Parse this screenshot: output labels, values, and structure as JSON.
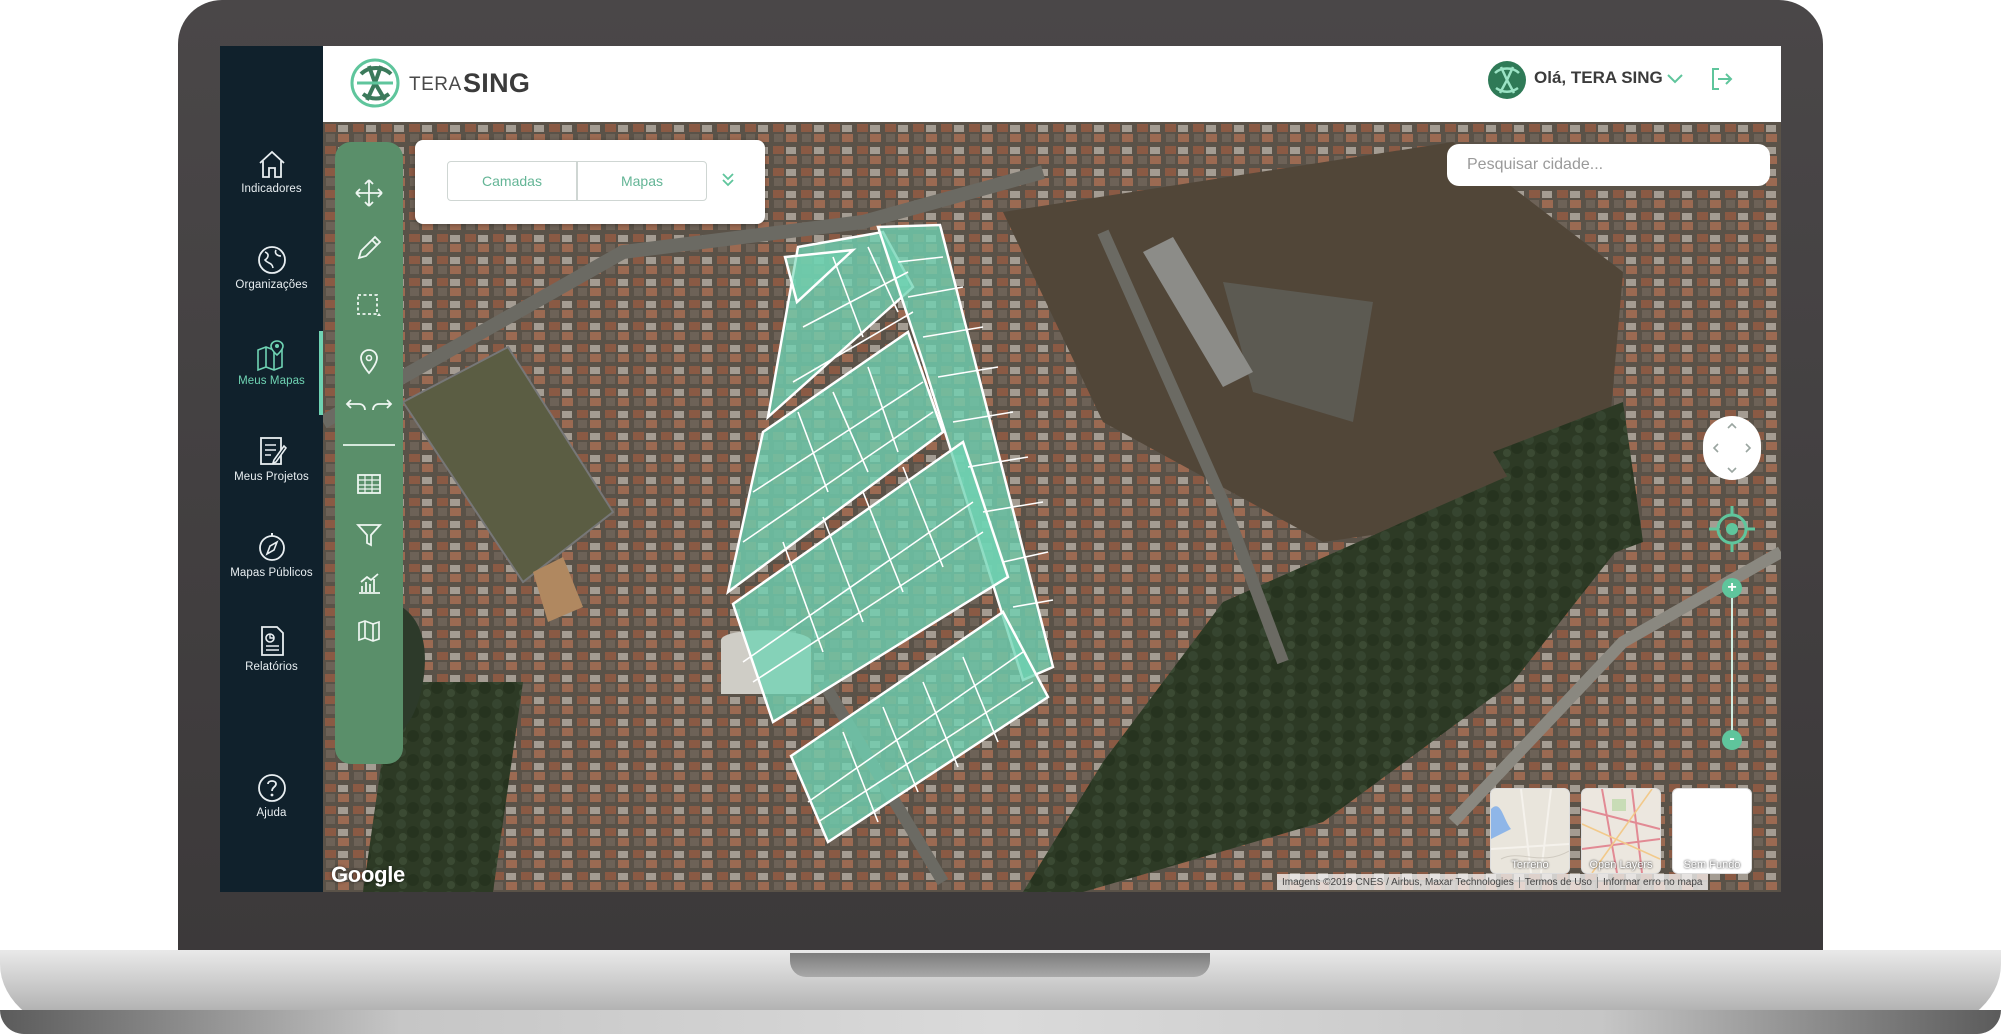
{
  "brand": {
    "prefix": "TERA",
    "name": "SING"
  },
  "header": {
    "greeting": "Olá, TERA SING"
  },
  "sidebar": {
    "items": [
      {
        "label": "Indicadores",
        "icon": "home-icon"
      },
      {
        "label": "Organizações",
        "icon": "globe-icon"
      },
      {
        "label": "Meus Mapas",
        "icon": "map-pin-icon",
        "active": true
      },
      {
        "label": "Meus Projetos",
        "icon": "document-pen-icon"
      },
      {
        "label": "Mapas Públicos",
        "icon": "compass-icon"
      },
      {
        "label": "Relatórios",
        "icon": "report-icon"
      },
      {
        "label": "Ajuda",
        "icon": "help-icon"
      }
    ]
  },
  "tabs": [
    {
      "label": "Camadas"
    },
    {
      "label": "Mapas"
    }
  ],
  "search": {
    "placeholder": "Pesquisar cidade..."
  },
  "zoom": {
    "in": "+",
    "out": "-"
  },
  "basemaps": [
    {
      "label": "Terreno"
    },
    {
      "label": "Open Layers"
    },
    {
      "label": "Sem Fundo"
    }
  ],
  "map": {
    "watermark": "Google",
    "attribution": "Imagens ©2019 CNES / Airbus, Maxar Technologies",
    "terms": "Termos de Uso",
    "report": "Informar erro no mapa"
  },
  "colors": {
    "accent": "#5fc59c",
    "sidebar": "#10212c",
    "toolbar": "#5a8f6a",
    "lots": "#6fd3b3"
  }
}
